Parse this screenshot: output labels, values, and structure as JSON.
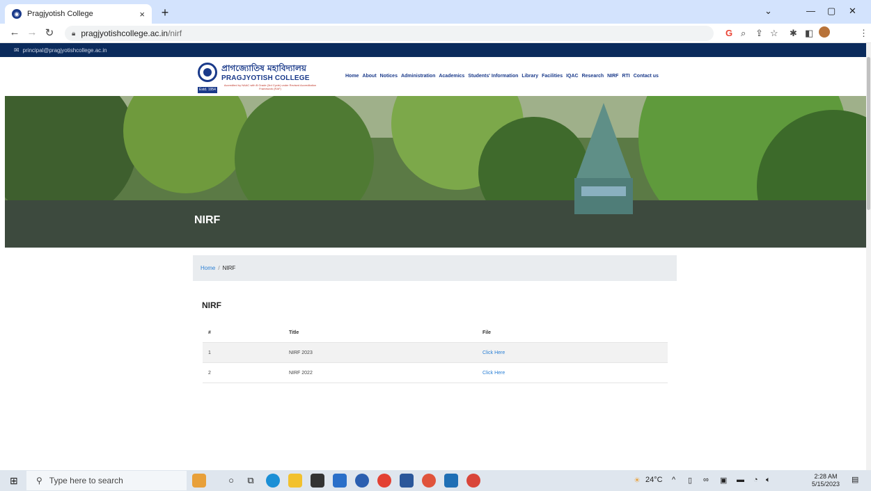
{
  "browser": {
    "tab_title": "Pragjyotish College",
    "tab_close": "×",
    "new_tab": "+",
    "url_host": "pragjyotishcollege.ac.in",
    "url_path": "/nirf"
  },
  "site": {
    "email": "principal@pragjyotishcollege.ac.in",
    "brand_bengali": "প্রাগজ্যোতিষ মহাবিদ্যালয়",
    "brand_english": "PRAGJYOTISH COLLEGE",
    "brand_subtitle": "Accredited by NAAC with B Grade (3rd Cycle) under Revised Accreditation Framework (RAF)",
    "estd": "Estd. 1954",
    "nav": [
      "Home",
      "About",
      "Notices",
      "Administration",
      "Academics",
      "Students' Information",
      "Library",
      "Facilities",
      "IQAC",
      "Research",
      "NIRF",
      "RTI",
      "Contact us"
    ],
    "banner_title": "NIRF"
  },
  "breadcrumb": {
    "home": "Home",
    "separator": "/",
    "current": "NIRF"
  },
  "section": {
    "title": "NIRF",
    "columns": [
      "#",
      "Title",
      "File"
    ],
    "rows": [
      {
        "num": "1",
        "title": "NIRF 2023",
        "file": "Click Here"
      },
      {
        "num": "2",
        "title": "NIRF 2022",
        "file": "Click Here"
      }
    ]
  },
  "taskbar": {
    "search_placeholder": "Type here to search",
    "weather": "24°C",
    "time": "2:28 AM",
    "date": "5/15/2023"
  },
  "colors": {
    "site_navy": "#0b2b5c",
    "brand_blue": "#1a3a8a",
    "link_blue": "#2a7fd4",
    "tab_strip": "#d3e3fd"
  }
}
